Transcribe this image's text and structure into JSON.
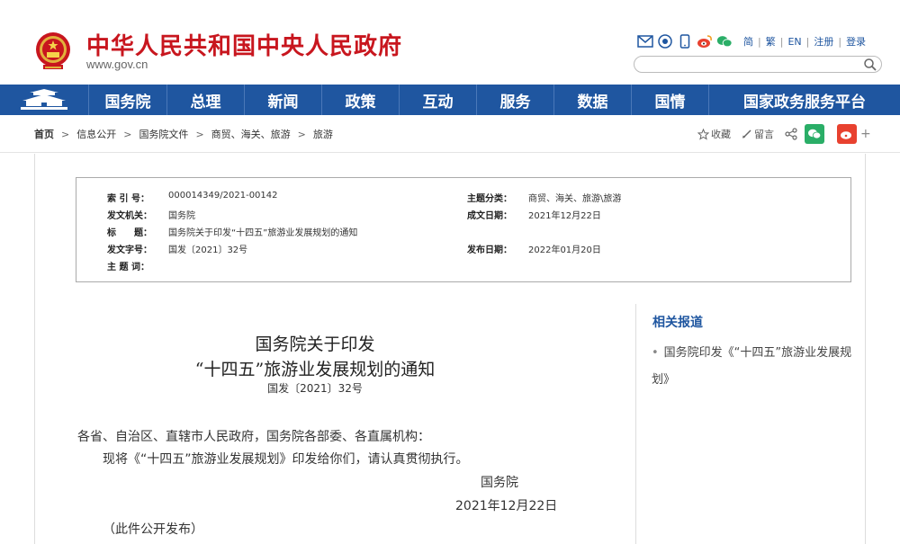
{
  "header": {
    "title": "中华人民共和国中央人民政府",
    "url": "www.gov.cn",
    "tools": [
      "mail-icon",
      "app-icon",
      "phone-icon",
      "weibo-icon",
      "wechat-icon"
    ],
    "lang": [
      "简",
      "繁",
      "EN",
      "注册",
      "登录"
    ],
    "search_placeholder": ""
  },
  "nav": {
    "items": [
      "国务院",
      "总理",
      "新闻",
      "政策",
      "互动",
      "服务",
      "数据",
      "国情",
      "国家政务服务平台"
    ]
  },
  "breadcrumb": [
    "首页",
    "信息公开",
    "国务院文件",
    "商贸、海关、旅游",
    "旅游"
  ],
  "share": {
    "collect": "收藏",
    "comment": "留言"
  },
  "meta": {
    "index_k": "索 引 号：",
    "index_v": "000014349/2021-00142",
    "category_k": "主题分类：",
    "category_v": "商贸、海关、旅游\\旅游",
    "issuer_k": "发文机关：",
    "issuer_v": "国务院",
    "date_k": "成文日期：",
    "date_v": "2021年12月22日",
    "title_k": "标　　题：",
    "title_v": "国务院关于印发“十四五”旅游业发展规划的通知",
    "docno_k": "发文字号：",
    "docno_v": "国发〔2021〕32号",
    "pub_k": "发布日期：",
    "pub_v": "2022年01月20日",
    "keywords_k": "主 题 词：",
    "keywords_v": ""
  },
  "article": {
    "title_line1": "国务院关于印发",
    "title_line2": "“十四五”旅游业发展规划的通知",
    "doc_number": "国发〔2021〕32号",
    "salutation": "各省、自治区、直辖市人民政府，国务院各部委、各直属机构：",
    "body": "现将《“十四五”旅游业发展规划》印发给你们，请认真贯彻执行。",
    "signature": "国务院",
    "sign_date": "2021年12月22日",
    "note": "（此件公开发布）"
  },
  "sidebar": {
    "title": "相关报道",
    "link": "国务院印发《“十四五”旅游业发展规划》"
  },
  "colors": {
    "brand_red": "#c8161e",
    "nav_blue": "#1f56a0",
    "wechat": "#2aae67",
    "weibo": "#e8412f"
  }
}
